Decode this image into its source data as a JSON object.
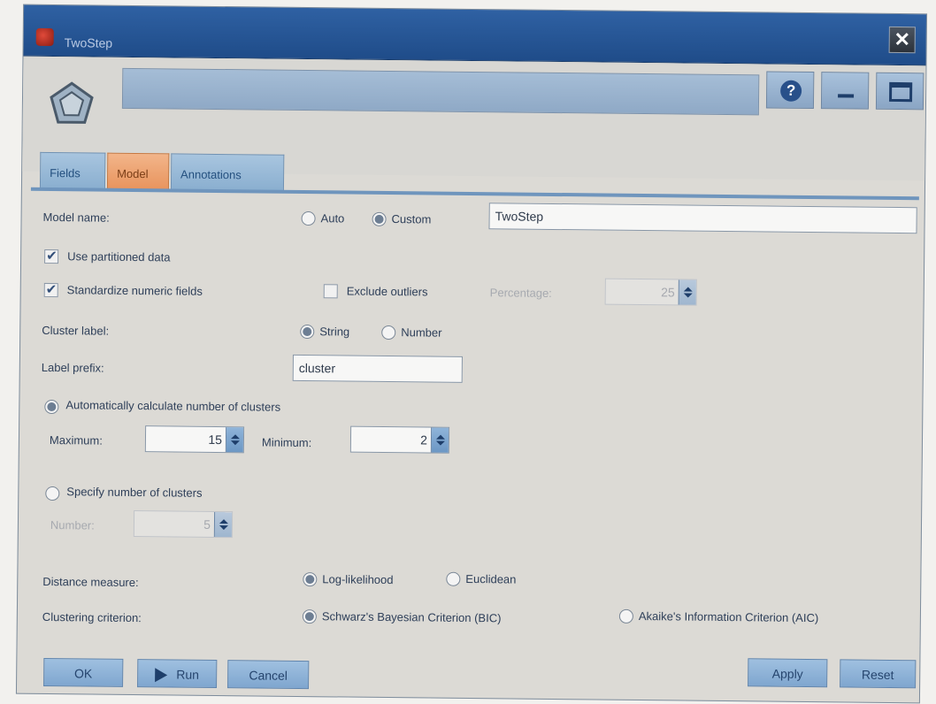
{
  "window": {
    "title": "TwoStep"
  },
  "tabs": [
    {
      "label": "Fields"
    },
    {
      "label": "Model"
    },
    {
      "label": "Annotations"
    }
  ],
  "model_name": {
    "label": "Model name:",
    "auto_label": "Auto",
    "custom_label": "Custom",
    "selected": "Custom",
    "value": "TwoStep"
  },
  "use_partitioned": {
    "label": "Use partitioned data",
    "checked": true
  },
  "standardize": {
    "label": "Standardize numeric fields",
    "checked": true
  },
  "exclude_outliers": {
    "label": "Exclude outliers",
    "checked": false
  },
  "percentage": {
    "label": "Percentage:",
    "value": "25"
  },
  "cluster_label": {
    "label": "Cluster label:",
    "string_label": "String",
    "number_label": "Number",
    "selected": "String"
  },
  "label_prefix": {
    "label": "Label prefix:",
    "value": "cluster"
  },
  "auto_calc": {
    "label": "Automatically calculate number of clusters",
    "selected": true,
    "max_label": "Maximum:",
    "max_value": "15",
    "min_label": "Minimum:",
    "min_value": "2"
  },
  "specify": {
    "label": "Specify number of clusters",
    "selected": false,
    "number_label": "Number:",
    "number_value": "5"
  },
  "distance": {
    "label": "Distance measure:",
    "opt1": "Log-likelihood",
    "opt2": "Euclidean",
    "selected": "Log-likelihood"
  },
  "criterion": {
    "label": "Clustering criterion:",
    "opt1": "Schwarz's Bayesian Criterion (BIC)",
    "opt2": "Akaike's Information Criterion (AIC)",
    "selected": "Schwarz's Bayesian Criterion (BIC)"
  },
  "buttons": {
    "ok": "OK",
    "run": "Run",
    "cancel": "Cancel",
    "apply": "Apply",
    "reset": "Reset"
  },
  "colors": {
    "accent": "#2f61a3",
    "active_tab": "#e8935c",
    "tab": "#89aecf"
  }
}
